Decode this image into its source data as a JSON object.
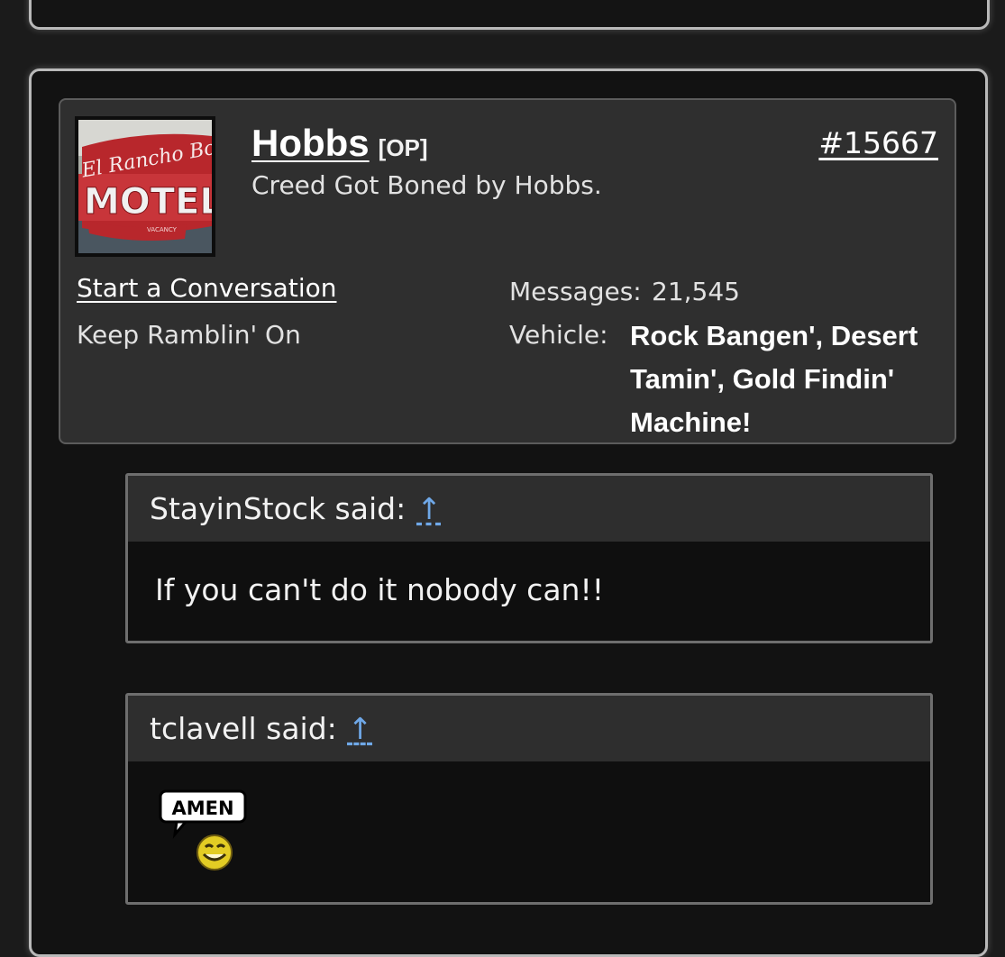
{
  "post": {
    "author": {
      "username": "Hobbs",
      "badge": "[OP]",
      "title": "Creed Got Boned by Hobbs.",
      "avatar_text": {
        "line1": "El Rancho Boulder",
        "line2": "MOTEL",
        "line3": "VACANCY"
      }
    },
    "post_number": "#15667",
    "links": {
      "start_conversation": "Start a Conversation",
      "tagline": "Keep Ramblin' On"
    },
    "stats": {
      "messages_label": "Messages:",
      "messages_value": "21,545",
      "vehicle_label": "Vehicle:",
      "vehicle_value": "Rock Bangen', Desert Tamin', Gold Findin' Machine!"
    },
    "quotes": [
      {
        "attribution": "StayinStock said:",
        "arrow": "↑",
        "text": "If you can't do it nobody can!!"
      },
      {
        "attribution": "tclavell said:",
        "arrow": "↑",
        "smiley_text": "AMEN"
      }
    ]
  },
  "colors": {
    "background": "#1b1b1b",
    "card": "#2f2f2f",
    "quote_header": "#2e2e2e",
    "quote_body": "#0f0f0f",
    "link_arrow": "#6fa8e8",
    "border": "#b9b9b9"
  }
}
